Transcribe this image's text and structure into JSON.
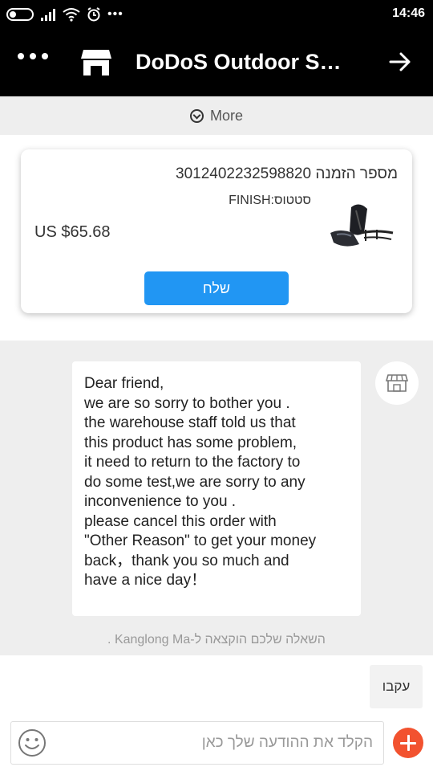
{
  "status_bar": {
    "time": "14:46",
    "more": "•••"
  },
  "header": {
    "title": "DoDoS Outdoor St..."
  },
  "more_bar": {
    "label": "More"
  },
  "order": {
    "number_label": "מספר הזמנה 3012402232598820",
    "status_label": "סטטוס:FINISH",
    "price": "US $65.68",
    "send_button": "שלח"
  },
  "chat": {
    "message_lines": [
      "Dear friend,",
      "we are so sorry to bother you .",
      "the warehouse staff told us that",
      "this product has some problem,",
      "it need to return to the factory to",
      "do some test,we are sorry to any",
      "inconvenience to you .",
      "please cancel this order with",
      "\"Other Reason\" to get your money",
      "back，thank you so much and",
      "have a nice day！"
    ],
    "assignment_note": "השאלה שלכם הוקצאה ל-Kanglong Ma ."
  },
  "quick_reply": {
    "label": "עקבו"
  },
  "input": {
    "placeholder": "הקלד את ההודעה שלך כאן",
    "value": ""
  },
  "colors": {
    "accent_blue": "#2196f3",
    "add_button_red": "#f2522f",
    "header_bg": "#000000"
  }
}
